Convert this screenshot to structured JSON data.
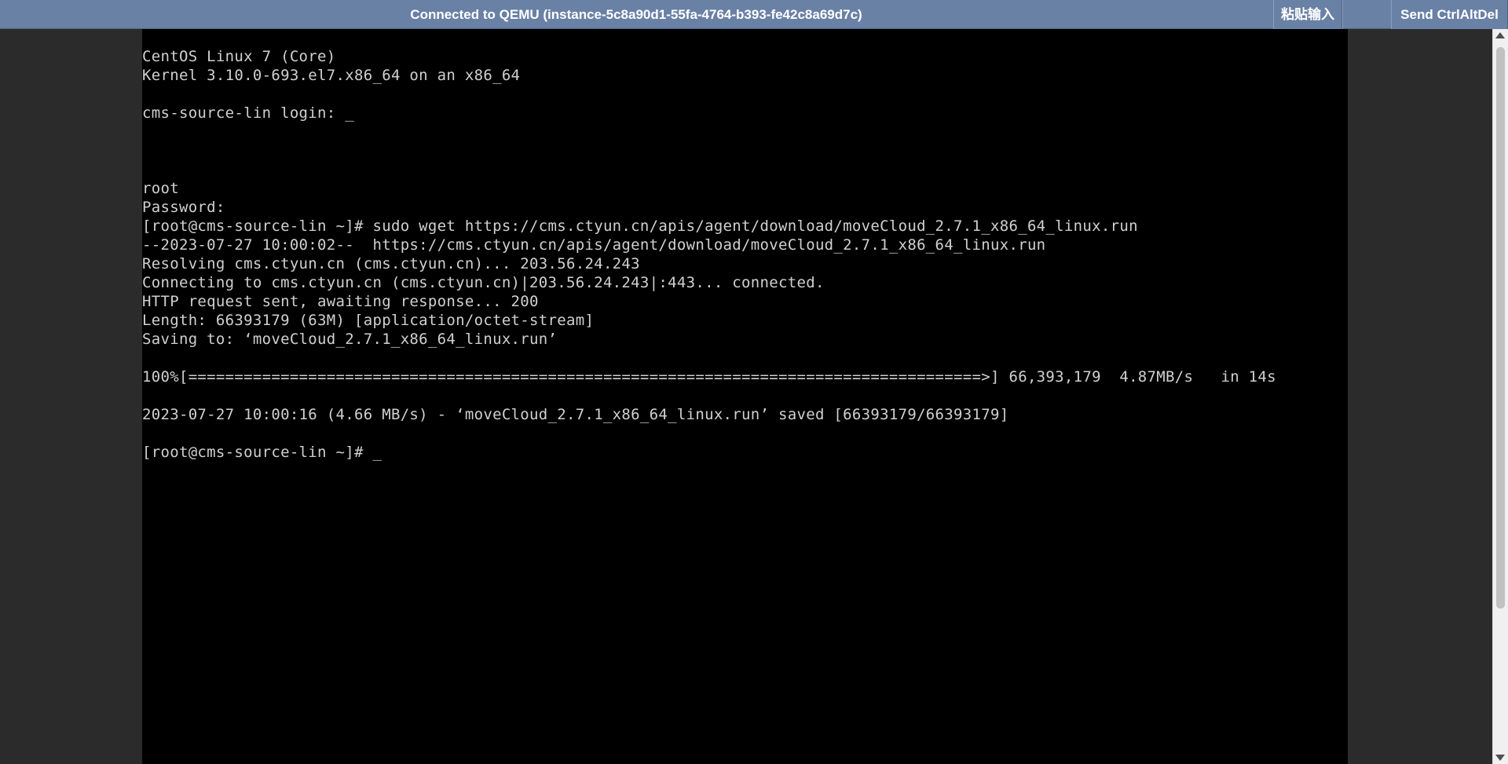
{
  "topbar": {
    "status": "Connected to QEMU (instance-5c8a90d1-55fa-4764-b393-fe42c8a69d7c)",
    "paste_label": "粘贴输入",
    "cad_label": "Send CtrlAltDel",
    "color": "#6a81a6"
  },
  "console": {
    "background": "#000000",
    "foreground": "#d0d0d0",
    "lines": [
      "CentOS Linux 7 (Core)",
      "Kernel 3.10.0-693.el7.x86_64 on an x86_64",
      "",
      "cms-source-lin login: _",
      "",
      "",
      "",
      "root",
      "Password:",
      "[root@cms-source-lin ~]# sudo wget https://cms.ctyun.cn/apis/agent/download/moveCloud_2.7.1_x86_64_linux.run",
      "--2023-07-27 10:00:02--  https://cms.ctyun.cn/apis/agent/download/moveCloud_2.7.1_x86_64_linux.run",
      "Resolving cms.ctyun.cn (cms.ctyun.cn)... 203.56.24.243",
      "Connecting to cms.ctyun.cn (cms.ctyun.cn)|203.56.24.243|:443... connected.",
      "HTTP request sent, awaiting response... 200",
      "Length: 66393179 (63M) [application/octet-stream]",
      "Saving to: ‘moveCloud_2.7.1_x86_64_linux.run’",
      "",
      "100%[======================================================================================>] 66,393,179  4.87MB/s   in 14s",
      "",
      "2023-07-27 10:00:16 (4.66 MB/s) - ‘moveCloud_2.7.1_x86_64_linux.run’ saved [66393179/66393179]",
      "",
      "[root@cms-source-lin ~]# _"
    ]
  },
  "icons": {
    "scroll_up": "scroll-up-arrow-icon",
    "scroll_down": "scroll-down-arrow-icon"
  }
}
